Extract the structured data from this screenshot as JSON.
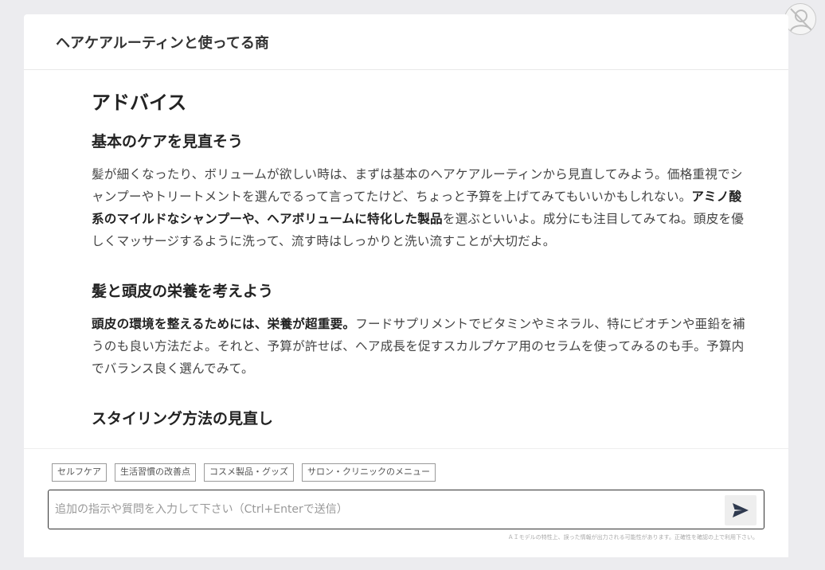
{
  "header": {
    "title": "ヘアケアルーティンと使ってる商"
  },
  "content": {
    "heading": "アドバイス",
    "sections": [
      {
        "title": "基本のケアを見直そう",
        "text_before": "髪が細くなったり、ボリュームが欲しい時は、まずは基本のヘアケアルーティンから見直してみよう。価格重視でシャンプーやトリートメントを選んでるって言ってたけど、ちょっと予算を上げてみてもいいかもしれない。",
        "bold": "アミノ酸系のマイルドなシャンプーや、ヘアボリュームに特化した製品",
        "text_after": "を選ぶといいよ。成分にも注目してみてね。頭皮を優しくマッサージするように洗って、流す時はしっかりと洗い流すことが大切だよ。"
      },
      {
        "title": "髪と頭皮の栄養を考えよう",
        "bold": "頭皮の環境を整えるためには、栄養が超重要。",
        "text_after": "フードサプリメントでビタミンやミネラル、特にビオチンや亜鉛を補うのも良い方法だよ。それと、予算が許せば、ヘア成長を促すスカルプケア用のセラムを使ってみるのも手。予算内でバランス良く選んでみて。"
      },
      {
        "title": "スタイリング方法の見直し"
      }
    ]
  },
  "chips": [
    "セルフケア",
    "生活習慣の改善点",
    "コスメ製品・グッズ",
    "サロン・クリニックのメニュー"
  ],
  "input": {
    "placeholder": "追加の指示や質問を入力して下さい（Ctrl+Enterで送信）",
    "value": ""
  },
  "disclaimer": "ＡＩモデルの特性上、誤った情報が出力される可能性があります。正確性を確認の上で利用下さい。",
  "icons": {
    "send": "send-icon",
    "avatar": "user-placeholder-icon"
  },
  "colors": {
    "background": "#ececef",
    "panel": "#ffffff",
    "send_icon": "#2f3a4f"
  }
}
